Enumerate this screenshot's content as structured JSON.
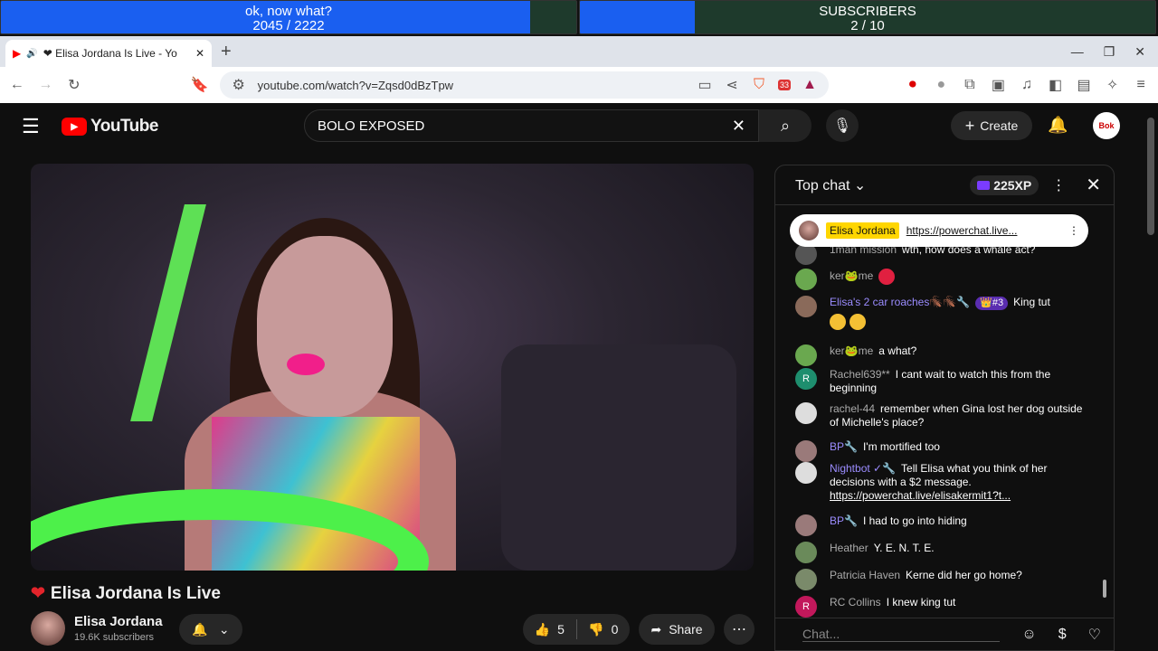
{
  "overlay": {
    "left_title": "ok, now what?",
    "left_value": "2045  /  2222",
    "left_progress": 0.92,
    "right_title": "SUBSCRIBERS",
    "right_value": "2  /  10",
    "right_progress": 0.2
  },
  "browser": {
    "tab_title": "❤ Elisa Jordana Is Live - Yo",
    "new_tab": "+",
    "url": "youtube.com/watch?v=Zqsd0dBzTpw",
    "brave_count": "33"
  },
  "youtube": {
    "logo": "YouTube",
    "search_query": "BOLO EXPOSED",
    "create_label": "Create",
    "avatar_text": "Bok"
  },
  "video": {
    "title": "Elisa Jordana Is Live",
    "channel": "Elisa Jordana",
    "subscribers": "19.6K subscribers",
    "likes": "5",
    "dislikes": "0",
    "share_label": "Share"
  },
  "chat": {
    "header": "Top chat",
    "xp": "225XP",
    "pinned": {
      "author": "Elisa Jordana",
      "text": "https://powerchat.live..."
    },
    "input_placeholder": "Chat...",
    "messages": [
      {
        "author": "1man mission",
        "text": "wth, how does a whale act?",
        "avatar_color": "#555",
        "initial": ""
      },
      {
        "author": "ker🐸me",
        "text": "",
        "avatar_color": "#6aa84f",
        "initial": ""
      },
      {
        "author": "Elisa's 2 car roaches🪳🪳🔧",
        "rank": "👑#3",
        "text": "King tut",
        "avatar_color": "#8a6a5a",
        "initial": ""
      },
      {
        "author": "ker🐸me",
        "text": "a what?",
        "avatar_color": "#6aa84f",
        "initial": ""
      },
      {
        "author": "Rachel639**",
        "text": "I cant wait to watch this from the beginning",
        "avatar_color": "#1e8e6e",
        "initial": "R"
      },
      {
        "author": "rachel-44",
        "text": "remember when Gina lost her dog outside of Michelle's place?",
        "avatar_color": "#ddd",
        "initial": ""
      },
      {
        "author": "BP🔧",
        "text": "I'm mortified too",
        "avatar_color": "#9a7a7a",
        "initial": ""
      },
      {
        "author": "Nightbot ✓🔧",
        "text": "Tell Elisa what you think of her decisions with a $2 message.",
        "link": "https://powerchat.live/elisakermit1?t...",
        "avatar_color": "#ddd",
        "initial": ""
      },
      {
        "author": "BP🔧",
        "text": "I had to go into hiding",
        "avatar_color": "#9a7a7a",
        "initial": ""
      },
      {
        "author": "Heather",
        "text": "Y. E. N. T. E.",
        "avatar_color": "#6a8a5a",
        "initial": ""
      },
      {
        "author": "Patricia Haven",
        "text": "Kerne did her go home?",
        "avatar_color": "#7a8a6a",
        "initial": ""
      },
      {
        "author": "RC Collins",
        "text": "I knew king tut",
        "avatar_color": "#c2185b",
        "initial": "R"
      }
    ]
  }
}
